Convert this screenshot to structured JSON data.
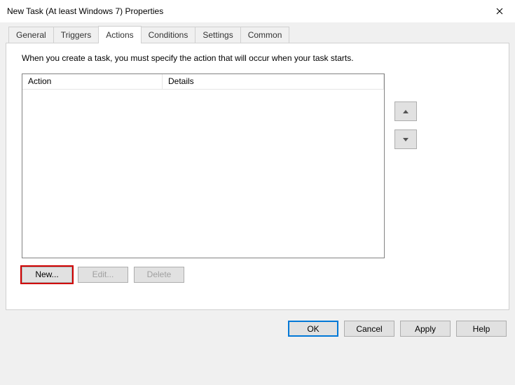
{
  "window": {
    "title": "New Task (At least Windows 7) Properties"
  },
  "tabs": {
    "general": "General",
    "triggers": "Triggers",
    "actions": "Actions",
    "conditions": "Conditions",
    "settings": "Settings",
    "common": "Common"
  },
  "panel": {
    "description": "When you create a task, you must specify the action that will occur when your task starts.",
    "columns": {
      "action": "Action",
      "details": "Details"
    }
  },
  "buttons": {
    "new": "New...",
    "edit": "Edit...",
    "delete": "Delete",
    "ok": "OK",
    "cancel": "Cancel",
    "apply": "Apply",
    "help": "Help"
  }
}
